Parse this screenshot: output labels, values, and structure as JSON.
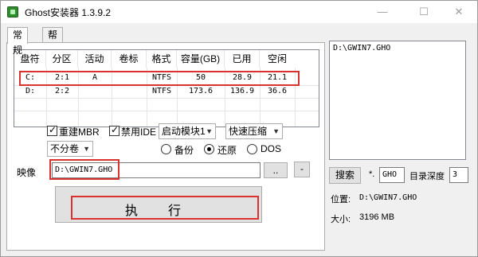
{
  "window": {
    "title": "Ghost安装器 1.3.9.2",
    "minimize": "—",
    "maximize": "☐",
    "close": "✕"
  },
  "tabs": [
    "常规",
    "帮助"
  ],
  "partition_table": {
    "columns": [
      "盘符",
      "分区",
      "活动",
      "卷标",
      "格式",
      "容量(GB)",
      "已用",
      "空闲"
    ],
    "rows": [
      [
        "C:",
        "2:1",
        "A",
        "",
        "NTFS",
        "50",
        "28.9",
        "21.1"
      ],
      [
        "D:",
        "2:2",
        "",
        "",
        "NTFS",
        "173.6",
        "136.9",
        "36.6"
      ]
    ]
  },
  "options": {
    "rebuild_mbr": "重建MBR",
    "rebuild_mbr_checked": true,
    "disable_ide": "禁用IDE",
    "disable_ide_checked": true,
    "boot_module": "启动模块1",
    "compression": "快速压缩",
    "split": "不分卷",
    "mode_backup": "备份",
    "mode_restore": "还原",
    "mode_dos": "DOS",
    "selected_mode": "restore"
  },
  "image": {
    "label": "映像",
    "path": "D:\\GWIN7.GHO",
    "browse_label": "..",
    "minus_label": "-"
  },
  "execute_label": "执　　行",
  "right_panel": {
    "list_items": [
      "D:\\GWIN7.GHO"
    ],
    "search_label": "搜索",
    "ext_prefix": "*.",
    "ext_value": "GHO",
    "depth_label": "目录深度",
    "depth_value": "3",
    "location_label": "位置: ",
    "location_value": "D:\\GWIN7.GHO",
    "size_label": "大小: ",
    "size_value": "3196 MB"
  },
  "colors": {
    "highlight_red": "#d9322f",
    "window_bg": "#f0f0f0"
  }
}
